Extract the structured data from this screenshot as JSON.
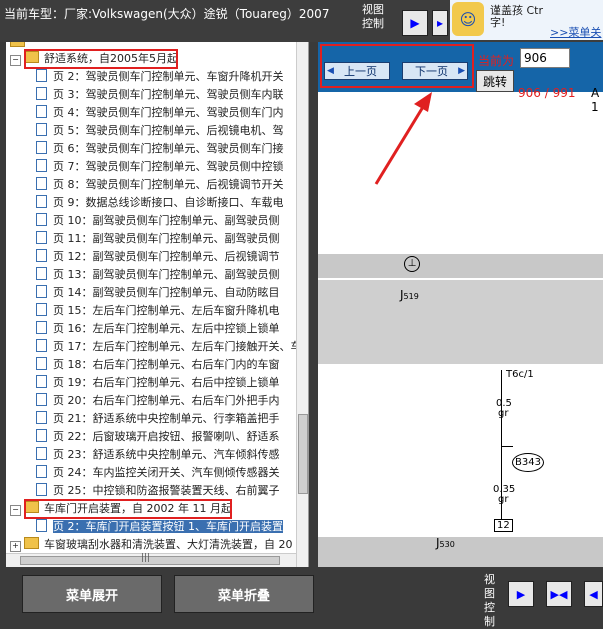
{
  "header": {
    "model": "当前车型：厂家:Volkswagen(大众）途锐（Touareg）2007",
    "view_control_label": "视图控制",
    "logo_line1": "谨盖孩  Ctr",
    "logo_line2": "字!",
    "logo_link": ">>菜单关"
  },
  "tree": {
    "top_partial": "",
    "folder1": "舒适系统，自2005年5月起",
    "pages": [
      "页 2：驾驶员侧车门控制单元、车窗升降机开关",
      "页 3：驾驶员侧车门控制单元、驾驶员侧车内联",
      "页 4：驾驶员侧车门控制单元、驾驶员侧车门内",
      "页 5：驾驶员侧车门控制单元、后视镜电机、驾",
      "页 6：驾驶员侧车门控制单元、驾驶员侧车门接",
      "页 7：驾驶员侧车门控制单元、驾驶员侧中控锁",
      "页 8：驾驶员侧车门控制单元、后视镜调节开关",
      "页 9：数据总线诊断接口、自诊断接口、车载电",
      "页 10：副驾驶员侧车门控制单元、副驾驶员侧",
      "页 11：副驾驶员侧车门控制单元、副驾驶员侧",
      "页 12：副驾驶员侧车门控制单元、后视镜调节",
      "页 13：副驾驶员侧车门控制单元、副驾驶员侧",
      "页 14：副驾驶员侧车门控制单元、自动防眩目",
      "页 15：左后车门控制单元、左后车窗升降机电",
      "页 16：左后车门控制单元、左后中控锁上锁单",
      "页 17：左后车门控制单元、左后车门接触开关、车",
      "页 18：右后车门控制单元、右后车门内的车窗",
      "页 19：右后车门控制单元、右后中控锁上锁单",
      "页 20：右后车门控制单元、右后车门外把手内",
      "页 21：舒适系统中央控制单元、行李箱盖把手",
      "页 22：后窗玻璃开启按钮、报警喇叭、舒适系",
      "页 23：舒适系统中央控制单元、汽车倾斜传感",
      "页 24：车内监控关闭开关、汽车侧倾传感器关",
      "页 25：中控锁和防盗报警装置天线、右前翼子"
    ],
    "folder2": "车库门开启装置，自 2002 年 11 月起",
    "selected_page": "页 2：车库门开启装置按钮 1、车库门开启装置",
    "folder3": "车窗玻璃刮水器和清洗装置、大灯清洗装置，自 20",
    "expand_plus": "+",
    "expand_minus": "−",
    "hscroll_marks": "|||"
  },
  "viewer": {
    "prev_label": "上一页",
    "next_label": "下一页",
    "current_label": "当前为",
    "current_value": "906",
    "jump_label": "跳转",
    "page_count": "906 / 991",
    "page_suffix": "A 1"
  },
  "diagram": {
    "j519": "J",
    "j519_sub": "519",
    "t6c": "T6c/1",
    "wire1_size": "0.5",
    "wire1_color": "gr",
    "b343": "B343",
    "wire2_size": "0.35",
    "wire2_color": "gr",
    "pin": "12",
    "j530": "J",
    "j530_sub": "530"
  },
  "bottom": {
    "expand_label": "菜单展开",
    "collapse_label": "菜单折叠",
    "view_control_label": "视图控制"
  },
  "colors": {
    "highlight": "#e02020",
    "nav_bg": "#1565a8",
    "folder": "#f0c24a"
  }
}
